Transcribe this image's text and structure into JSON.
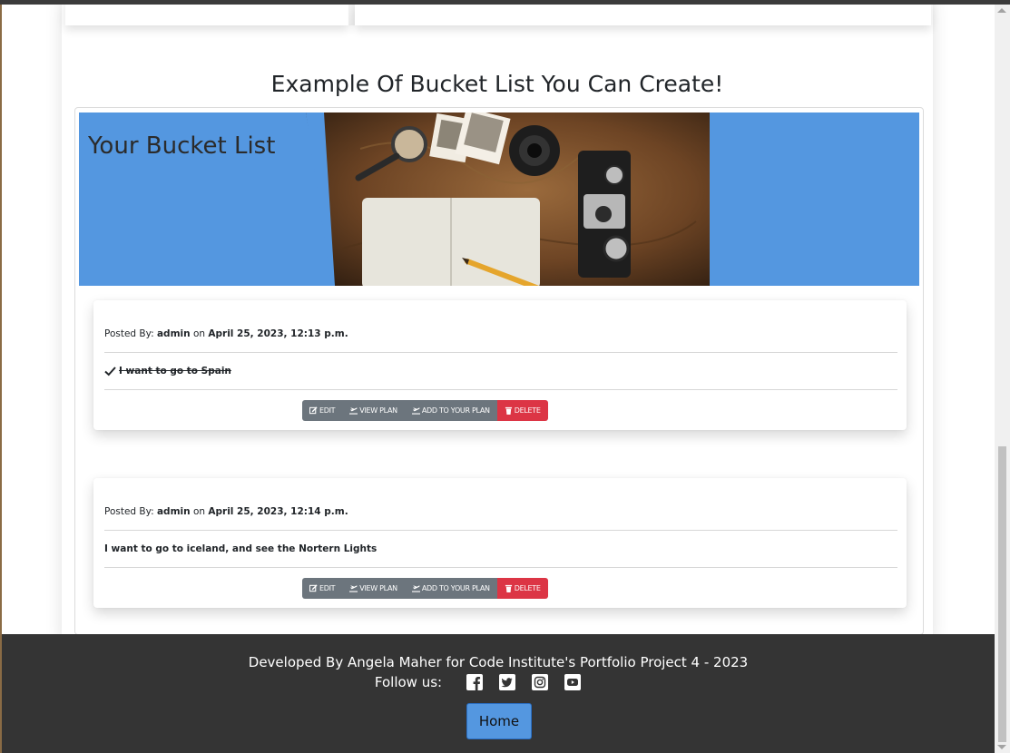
{
  "section_title": "Example Of Bucket List You Can Create!",
  "banner": {
    "title": "Your Bucket List"
  },
  "posts": [
    {
      "posted_by_label": "Posted By:",
      "author": "admin",
      "on_label": "on",
      "date": "April 25, 2023, 12:13 p.m.",
      "text": "I want to go to Spain",
      "completed": true
    },
    {
      "posted_by_label": "Posted By:",
      "author": "admin",
      "on_label": "on",
      "date": "April 25, 2023, 12:14 p.m.",
      "text": "I want to go to iceland, and see the Nortern Lights",
      "completed": false
    }
  ],
  "actions": {
    "edit": "EDIT",
    "view_plan": "VIEW PLAN",
    "add_to_plan": "ADD TO YOUR PLAN",
    "delete": "DELETE"
  },
  "footer": {
    "credit": "Developed By Angela Maher for Code Institute's Portfolio Project 4 - 2023",
    "follow_label": "Follow us:",
    "social_icons": [
      "facebook-icon",
      "twitter-icon",
      "instagram-icon",
      "youtube-icon"
    ],
    "home_button": "Home"
  },
  "colors": {
    "banner_blue": "#5497e0",
    "button_gray": "#6c757d",
    "button_red": "#dc3545",
    "footer_bg": "#343434"
  }
}
